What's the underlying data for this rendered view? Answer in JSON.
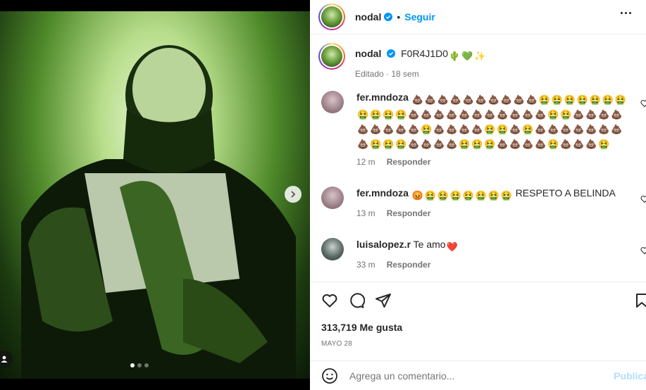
{
  "post": {
    "username": "nodal",
    "follow_label": "Seguir",
    "separator": "•",
    "caption_text": "F0R4J1D0",
    "caption_meta": "Editado · 18 sem",
    "likes": "313,719 Me gusta",
    "date": "MAYO 28"
  },
  "comments": [
    {
      "user": "fer.mndoza",
      "emoji_line": [
        "poop",
        "poop",
        "poop",
        "poop",
        "poop",
        "poop",
        "poop",
        "poop",
        "poop",
        "poop",
        "vomit",
        "vomit",
        "vomit",
        "vomit",
        "vomit",
        "vomit",
        "vomit",
        "vomit",
        "vomit",
        "vomit",
        "vomit",
        "poop",
        "poop",
        "poop",
        "poop",
        "poop",
        "poop",
        "poop",
        "poop",
        "poop",
        "poop",
        "poop",
        "vomit",
        "vomit",
        "poop",
        "poop",
        "poop",
        "poop",
        "poop",
        "poop",
        "poop",
        "poop",
        "poop",
        "vomit",
        "poop",
        "poop",
        "poop",
        "poop",
        "vomit",
        "vomit",
        "poop",
        "vomit",
        "poop",
        "poop",
        "poop",
        "poop",
        "poop",
        "poop",
        "poop",
        "poop",
        "vomit",
        "vomit",
        "vomit",
        "poop",
        "poop",
        "poop",
        "poop",
        "vomit",
        "vomit",
        "vomit",
        "poop",
        "poop",
        "poop",
        "poop",
        "vomit",
        "poop",
        "poop",
        "poop",
        "vomit"
      ],
      "time": "12 m",
      "reply": "Responder"
    },
    {
      "user": "fer.mndoza",
      "emoji_line": [
        "angry",
        "vomit",
        "vomit",
        "vomit",
        "vomit",
        "vomit",
        "vomit",
        "vomit"
      ],
      "text": "RESPETO A BELINDA",
      "time": "13 m",
      "reply": "Responder"
    },
    {
      "user": "luisalopez.r",
      "text": "Te amo",
      "time": "33 m",
      "reply": "Responder"
    }
  ],
  "add_comment": {
    "placeholder": "Agrega un comentario...",
    "post_label": "Publica"
  },
  "icons": {
    "emoji_glyphs": {
      "poop": "💩",
      "vomit": "🤮",
      "angry": "😡",
      "cactus": "🌵",
      "green_heart": "💚",
      "sparkle": "✨",
      "red_heart": "❤️"
    }
  },
  "colors": {
    "accent": "#0095f6",
    "muted": "#737373",
    "text": "#262626",
    "post_disabled": "#b2dffc"
  }
}
